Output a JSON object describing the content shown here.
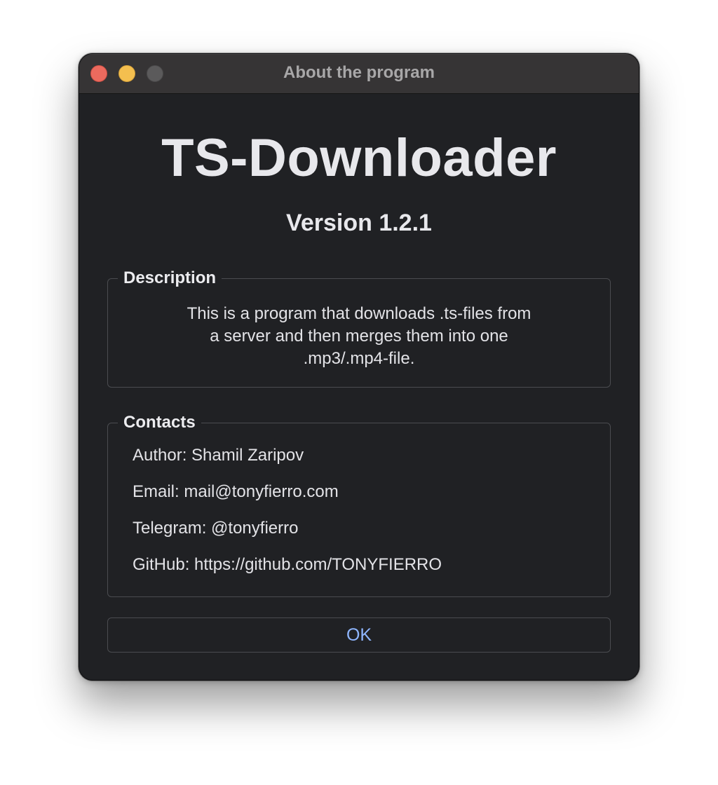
{
  "window": {
    "title": "About the program"
  },
  "app": {
    "name": "TS-Downloader",
    "version": "Version 1.2.1"
  },
  "description": {
    "label": "Description",
    "lines": [
      "This is a program that downloads .ts-files from",
      "a server and then merges them into one",
      ".mp3/.mp4-file."
    ]
  },
  "contacts": {
    "label": "Contacts",
    "author": "Author: Shamil Zaripov",
    "email": "Email: mail@tonyfierro.com",
    "telegram": "Telegram: @tonyfierro",
    "github": "GitHub: https://github.com/TONYFIERRO"
  },
  "buttons": {
    "ok_label": "OK"
  },
  "colors": {
    "window_background": "#202124",
    "titlebar_background": "#363435",
    "close_button": "#ec6a5e",
    "minimize_button": "#f4bf4f",
    "zoom_button": "#5b5a5b",
    "ok_text": "#8fb6ff"
  },
  "icons": {
    "close": "close-traffic-light-icon",
    "minimize": "minimize-traffic-light-icon",
    "zoom": "zoom-traffic-light-icon"
  }
}
